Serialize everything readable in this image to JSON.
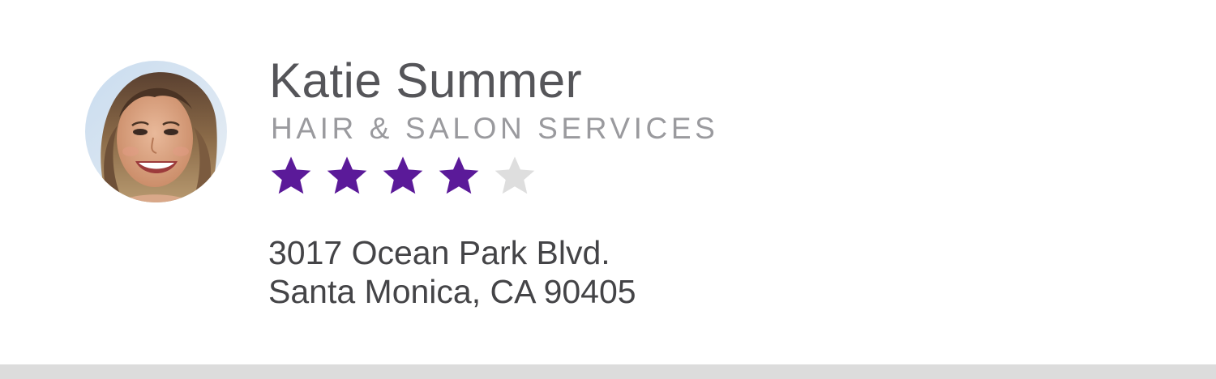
{
  "provider": {
    "name": "Katie Summer",
    "category": "HAIR & SALON SERVICES",
    "avatar_alt": "profile-photo",
    "rating": {
      "value": 4,
      "max": 5,
      "filled_color": "#5b1a99",
      "empty_color": "#dedede"
    },
    "address": {
      "line1": "3017 Ocean Park Blvd.",
      "line2": "Santa Monica, CA 90405"
    }
  },
  "icons": {
    "star": "star-icon"
  },
  "colors": {
    "name_text": "#555559",
    "category_text": "#9a9a9e",
    "address_text": "#444447",
    "divider": "#dcdcdc"
  }
}
